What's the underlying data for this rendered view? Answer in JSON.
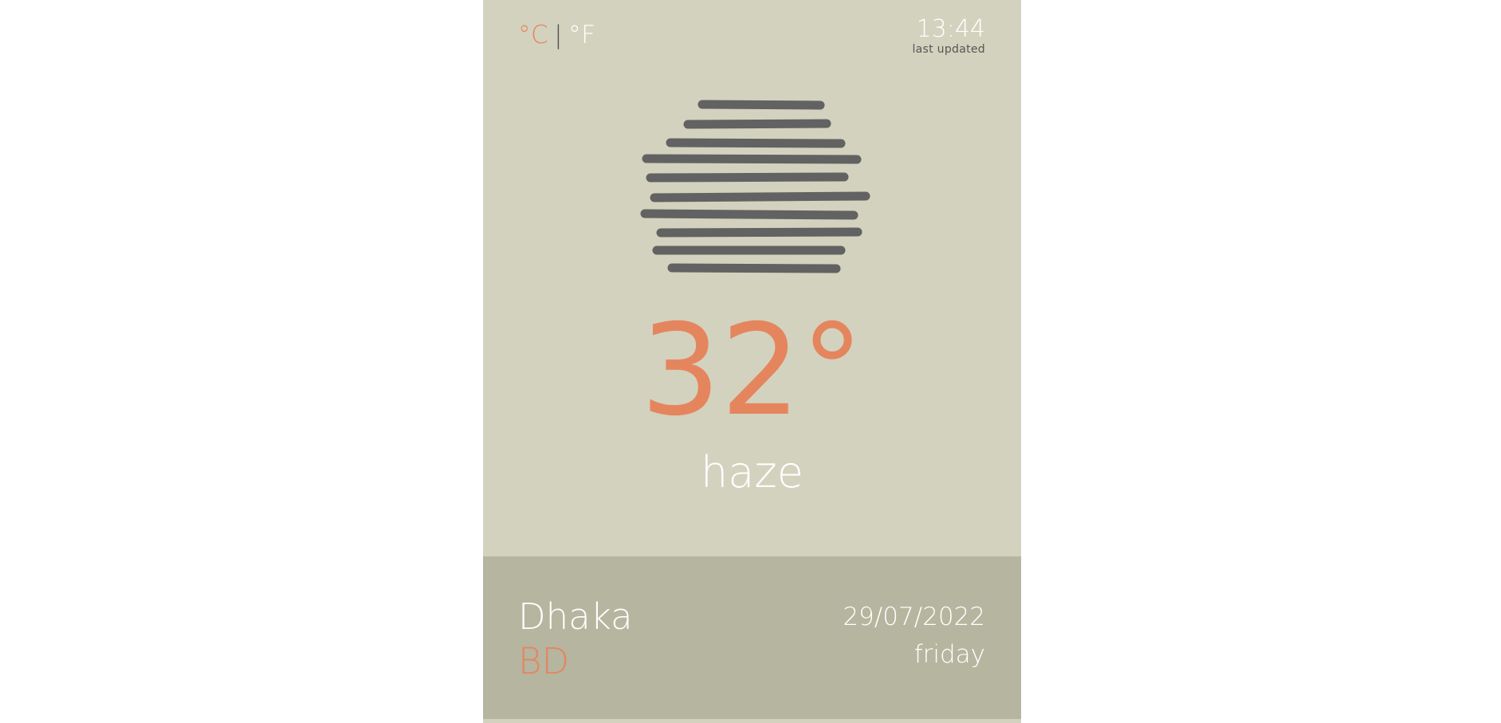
{
  "units": {
    "celsius_label": "°C",
    "separator": "|",
    "fahrenheit_label": "°F",
    "active": "celsius"
  },
  "last_updated": {
    "time": "13:44",
    "label": "last updated"
  },
  "weather": {
    "icon": "haze-icon",
    "temperature": "32°",
    "condition": "haze"
  },
  "location": {
    "city": "Dhaka",
    "country": "BD"
  },
  "date": {
    "date": "29/07/2022",
    "weekday": "friday"
  },
  "colors": {
    "card_background": "#d3d2be",
    "footer_background": "#b6b59f",
    "accent": "#e5855e",
    "icon_stroke": "#626262",
    "text_light": "#ffffff",
    "text_dark": "#555555"
  }
}
